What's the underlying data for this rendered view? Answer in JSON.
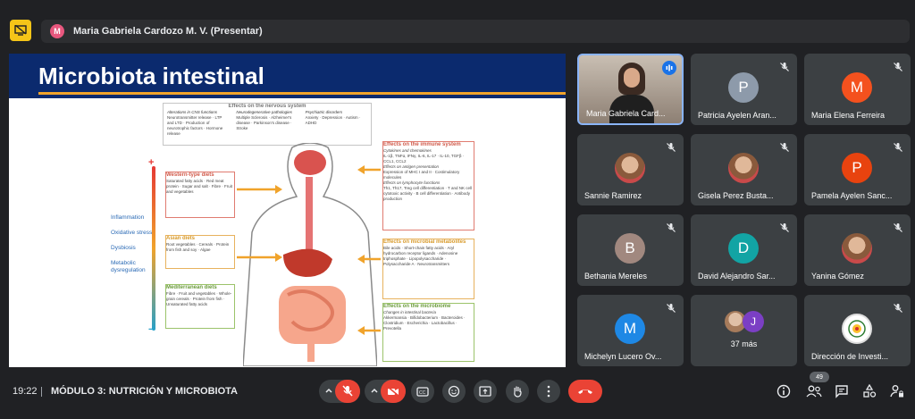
{
  "present_bar": {
    "presenter_initial": "M",
    "presenter_label": "Maria Gabriela Cardozo M. V. (Presentar)"
  },
  "slide": {
    "title": "Microbiota intestinal",
    "nervous": {
      "title": "Effects on the nervous system",
      "col1_head": "Alterations in CNS functions",
      "col1_items": "Neurotransmitter release · LTP and LTD · Production of neurotrophic factors · Hormone release",
      "col2_head": "Neurodegenerative pathologies",
      "col2_items": "Multiple Sclerosis · Alzheimer's disease · Parkinson's disease · Stroke",
      "col3_head": "Psychiatric disorders",
      "col3_items": "Anxiety · Depression · Autism · ADHD"
    },
    "western": {
      "title": "Western-type diets",
      "items": "Saturated fatty acids · Red meat protein · Sugar and salt · Fibre · Fruit and vegetables"
    },
    "asian": {
      "title": "Asian diets",
      "items": "Root vegetables · Cereals · Protein from fish and soy · Algae"
    },
    "mediterranean": {
      "title": "Mediterranean diets",
      "items": "Fibre · Fruit and vegetables · Whole-grain cereals · Protein from fish · Unsaturated fatty acids"
    },
    "immune": {
      "title": "Effects on the immune system",
      "sub1": "Cytokines and chemokines",
      "items1": "IL-1β, TNFα, IFNγ, IL-6, IL-17 · IL-10, TGFβ · CCL1, CCL2",
      "sub2": "Effects on antigen presentation",
      "items2": "Expression of MHC I and II · Costimulatory molecules",
      "sub3": "Effects on lymphocyte functions",
      "items3": "Th1, Th17, Treg cell differentiation · T and NK cell cytotoxic activity · B cell differentiation · Antibody production"
    },
    "microbial": {
      "title": "Effects on microbial metabolites",
      "items": "Bile acids · Short-chain fatty acids · Aryl hydrocarbon receptor ligands · Adenosine triphosphate · Lipopolysaccharide · Polysaccharide A · Neurotransmitters"
    },
    "microbiome": {
      "title": "Effects on the microbiome",
      "sub": "Changes in intestinal bacteria",
      "items": "Akkermansia · Bifidobacterium · Bacteroides · Clostridium · Escherichia · Lactobacillus · Prevotella"
    },
    "left_labels": [
      "Inflammation",
      "Oxidative stress",
      "Dysbiosis",
      "Metabolic dysregulation"
    ]
  },
  "participants": [
    {
      "name": "Maria Gabriela Card...",
      "type": "video"
    },
    {
      "name": "Patricia Ayelen Aran...",
      "initial": "P",
      "color": "#8d9aaa"
    },
    {
      "name": "Maria Elena Ferreira",
      "initial": "M",
      "color": "#f4511e"
    },
    {
      "name": "Sannie Ramirez",
      "type": "photo"
    },
    {
      "name": "Gisela Perez Busta...",
      "type": "photo"
    },
    {
      "name": "Pamela Ayelen Sanc...",
      "initial": "P",
      "color": "#e8430f"
    },
    {
      "name": "Bethania Mereles",
      "initial": "B",
      "color": "#a1887f"
    },
    {
      "name": "David Alejandro Sar...",
      "initial": "D",
      "color": "#12a4a4"
    },
    {
      "name": "Yanina Gómez",
      "type": "photo"
    },
    {
      "name": "Michelyn Lucero Ov...",
      "initial": "M",
      "color": "#1e88e5"
    },
    {
      "name": "37 más",
      "type": "more",
      "initial": "J"
    },
    {
      "name": "Dirección de Investi...",
      "type": "logo"
    }
  ],
  "bottom_bar": {
    "time": "19:22",
    "meeting_title": "MÓDULO 3: NUTRICIÓN Y MICROBIOTA",
    "participant_count": "49"
  }
}
